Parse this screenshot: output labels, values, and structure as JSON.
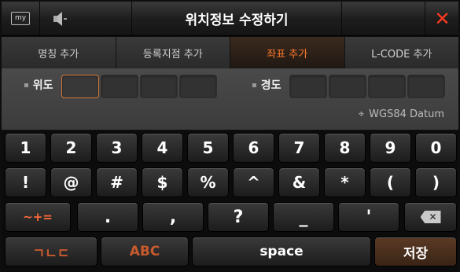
{
  "header": {
    "my_label": "my",
    "title": "위치정보 수정하기",
    "close_label": "✕"
  },
  "tabs": [
    {
      "label": "명칭 추가",
      "active": false
    },
    {
      "label": "등록지점 추가",
      "active": false
    },
    {
      "label": "좌표 추가",
      "active": true
    },
    {
      "label": "L-CODE 추가",
      "active": false
    }
  ],
  "coordinates": {
    "latitude_label": "위도",
    "longitude_label": "경도",
    "datum": "WGS84 Datum",
    "bullet": "▪",
    "datum_icon": "⌖"
  },
  "keyboard": {
    "row1": [
      "1",
      "2",
      "3",
      "4",
      "5",
      "6",
      "7",
      "8",
      "9",
      "0"
    ],
    "row2": [
      "!",
      "@",
      "#",
      "$",
      "%",
      "^",
      "&",
      "*",
      "(",
      ")"
    ],
    "row3": {
      "symbols": "~+=",
      "keys": [
        ".",
        ",",
        "?",
        "_",
        "'"
      ]
    },
    "row4": {
      "korean": "ㄱㄴㄷ",
      "abc": "ABC",
      "space": "space",
      "done": "저장"
    }
  },
  "colors": {
    "accent": "#ff7a2a",
    "close": "#ff3b1f"
  }
}
